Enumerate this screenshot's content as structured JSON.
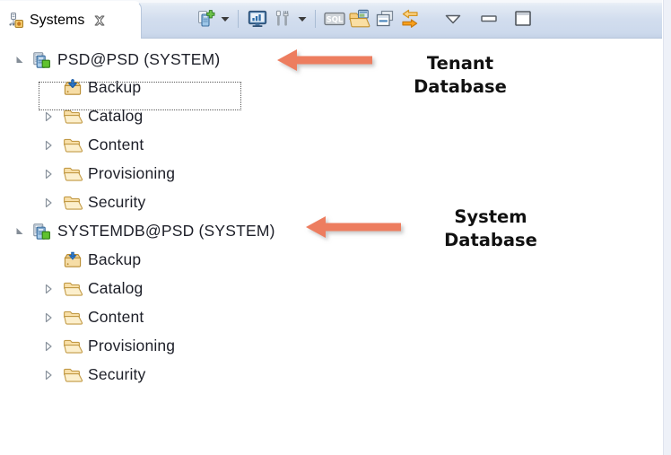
{
  "window": {
    "accent_blue": "#1d4f91",
    "header_bg": "#d2ddee",
    "tree_text_color": "#1d1f28",
    "annotation_color": "#ED7D5F",
    "annotation_text_color": "#111111"
  },
  "tab": {
    "label": "Systems",
    "icon": "systems-view-icon",
    "close_icon": "close-icon"
  },
  "toolbar": {
    "buttons": [
      {
        "id": "add-system",
        "icon": "add-system-icon",
        "tooltip": "Add System"
      },
      {
        "id": "add-system-menu",
        "icon": "chevron-down-icon",
        "tooltip": "Add System Menu"
      },
      {
        "id": "system-monitor",
        "icon": "system-monitor-icon",
        "tooltip": "System Monitor"
      },
      {
        "id": "administration",
        "icon": "administration-tools-icon",
        "tooltip": "Administration"
      },
      {
        "id": "administration-menu",
        "icon": "chevron-down-icon",
        "tooltip": "Administration Menu"
      },
      {
        "id": "sql-console",
        "icon": "sql-console-icon",
        "tooltip": "SQL Console"
      },
      {
        "id": "open-perspective",
        "icon": "open-folder-window-icon",
        "tooltip": "Open Perspective"
      },
      {
        "id": "collapse-all",
        "icon": "collapse-all-icon",
        "tooltip": "Collapse All"
      },
      {
        "id": "link-with-editor",
        "icon": "link-arrows-icon",
        "tooltip": "Link with Editor"
      },
      {
        "id": "view-menu",
        "icon": "view-menu-triangle-icon",
        "tooltip": "View Menu"
      },
      {
        "id": "minimize-view",
        "icon": "minimize-icon",
        "tooltip": "Minimize"
      },
      {
        "id": "maximize-view",
        "icon": "maximize-icon",
        "tooltip": "Maximize"
      }
    ]
  },
  "tree": {
    "nodes": [
      {
        "label": "PSD@PSD (SYSTEM)",
        "icon": "database-system-icon",
        "twisty": "expanded",
        "level": 0,
        "selected": true
      },
      {
        "label": "Backup",
        "icon": "backup-icon",
        "twisty": "none",
        "level": 1,
        "selected": false
      },
      {
        "label": "Catalog",
        "icon": "folder-icon",
        "twisty": "collapsed",
        "level": 1,
        "selected": false
      },
      {
        "label": "Content",
        "icon": "folder-icon",
        "twisty": "collapsed",
        "level": 1,
        "selected": false
      },
      {
        "label": "Provisioning",
        "icon": "folder-icon",
        "twisty": "collapsed",
        "level": 1,
        "selected": false
      },
      {
        "label": "Security",
        "icon": "folder-icon",
        "twisty": "collapsed",
        "level": 1,
        "selected": false
      },
      {
        "label": "SYSTEMDB@PSD (SYSTEM)",
        "icon": "database-system-icon",
        "twisty": "expanded",
        "level": 0,
        "selected": false
      },
      {
        "label": "Backup",
        "icon": "backup-icon",
        "twisty": "none",
        "level": 1,
        "selected": false
      },
      {
        "label": "Catalog",
        "icon": "folder-icon",
        "twisty": "collapsed",
        "level": 1,
        "selected": false
      },
      {
        "label": "Content",
        "icon": "folder-icon",
        "twisty": "collapsed",
        "level": 1,
        "selected": false
      },
      {
        "label": "Provisioning",
        "icon": "folder-icon",
        "twisty": "collapsed",
        "level": 1,
        "selected": false
      },
      {
        "label": "Security",
        "icon": "folder-icon",
        "twisty": "collapsed",
        "level": 1,
        "selected": false
      }
    ]
  },
  "annotations": [
    {
      "id": "tenant",
      "text": "Tenant\nDatabase",
      "arrow": "left-arrow-icon"
    },
    {
      "id": "system",
      "text": "System\nDatabase",
      "arrow": "left-arrow-icon"
    }
  ]
}
